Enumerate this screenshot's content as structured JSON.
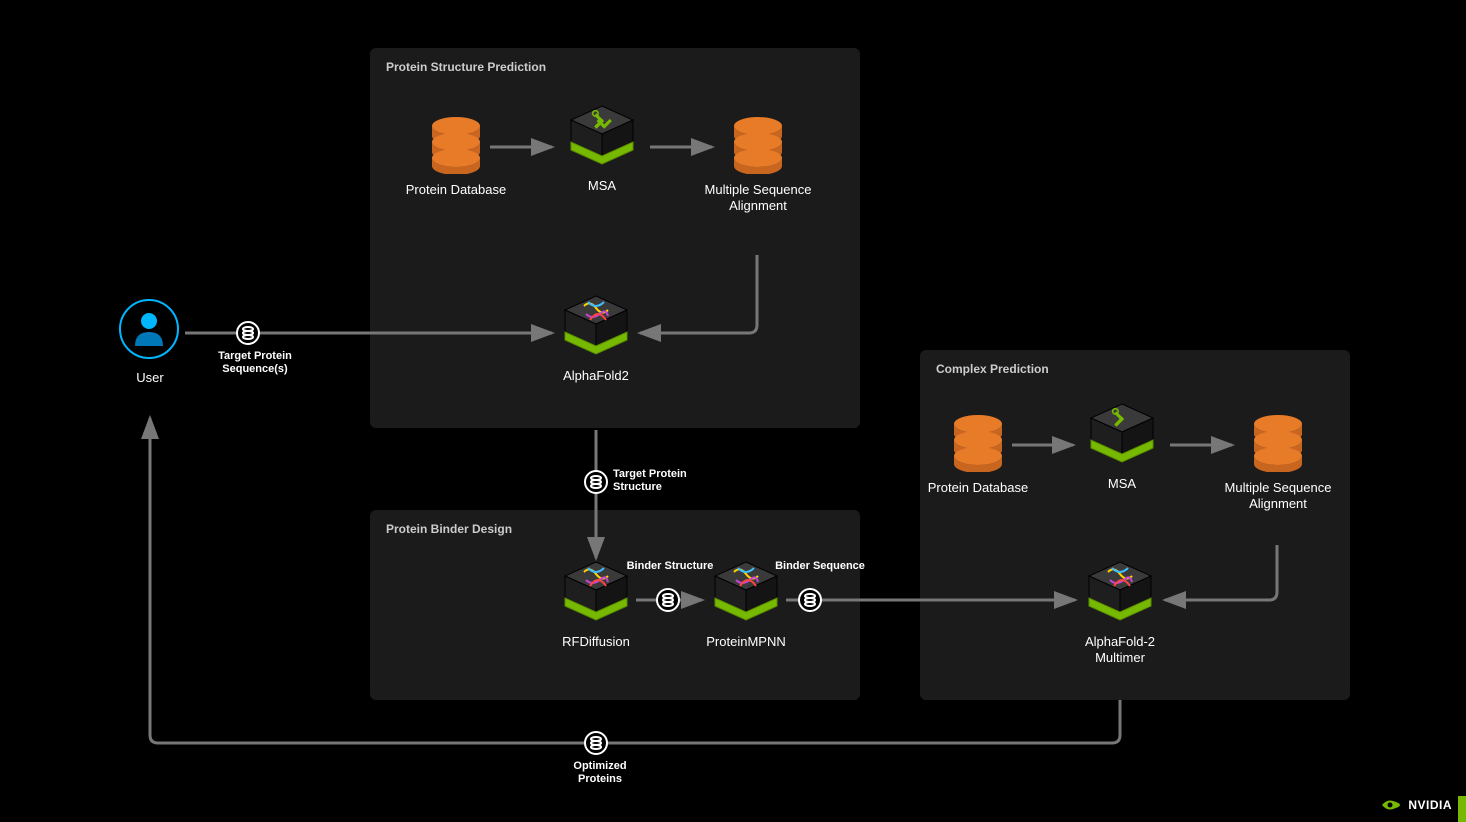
{
  "panels": {
    "psp": {
      "title": "Protein Structure Prediction"
    },
    "pbd": {
      "title": "Protein Binder Design"
    },
    "cp": {
      "title": "Complex Prediction"
    }
  },
  "nodes": {
    "user": {
      "label": "User"
    },
    "pdb1": {
      "label": "Protein Database"
    },
    "msa1": {
      "label": "MSA"
    },
    "msadb1": {
      "label": "Multiple Sequence Alignment"
    },
    "af2": {
      "label": "AlphaFold2"
    },
    "rfd": {
      "label": "RFDiffusion"
    },
    "pmpnn": {
      "label": "ProteinMPNN"
    },
    "pdb2": {
      "label": "Protein Database"
    },
    "msa2": {
      "label": "MSA"
    },
    "msadb2": {
      "label": "Multiple Sequence Alignment"
    },
    "af2m": {
      "label": "AlphaFold-2 Multimer"
    }
  },
  "edges": {
    "target_seq": {
      "label": "Target Protein Sequence(s)"
    },
    "target_struct": {
      "label": "Target Protein Structure"
    },
    "binder_struct": {
      "label": "Binder Structure"
    },
    "binder_seq": {
      "label": "Binder Sequence"
    },
    "optimized": {
      "label": "Optimized Proteins"
    }
  },
  "brand": {
    "name": "NVIDIA"
  },
  "colors": {
    "orange_top": "#e87b28",
    "orange_side": "#c86620",
    "green": "#76b900",
    "green_dark": "#5a8f00",
    "cube_top": "#3a3a3a",
    "cube_side": "#1e1e1e",
    "cube_side2": "#141414",
    "blue": "#00b6ff",
    "blue_dark": "#0077b6"
  }
}
